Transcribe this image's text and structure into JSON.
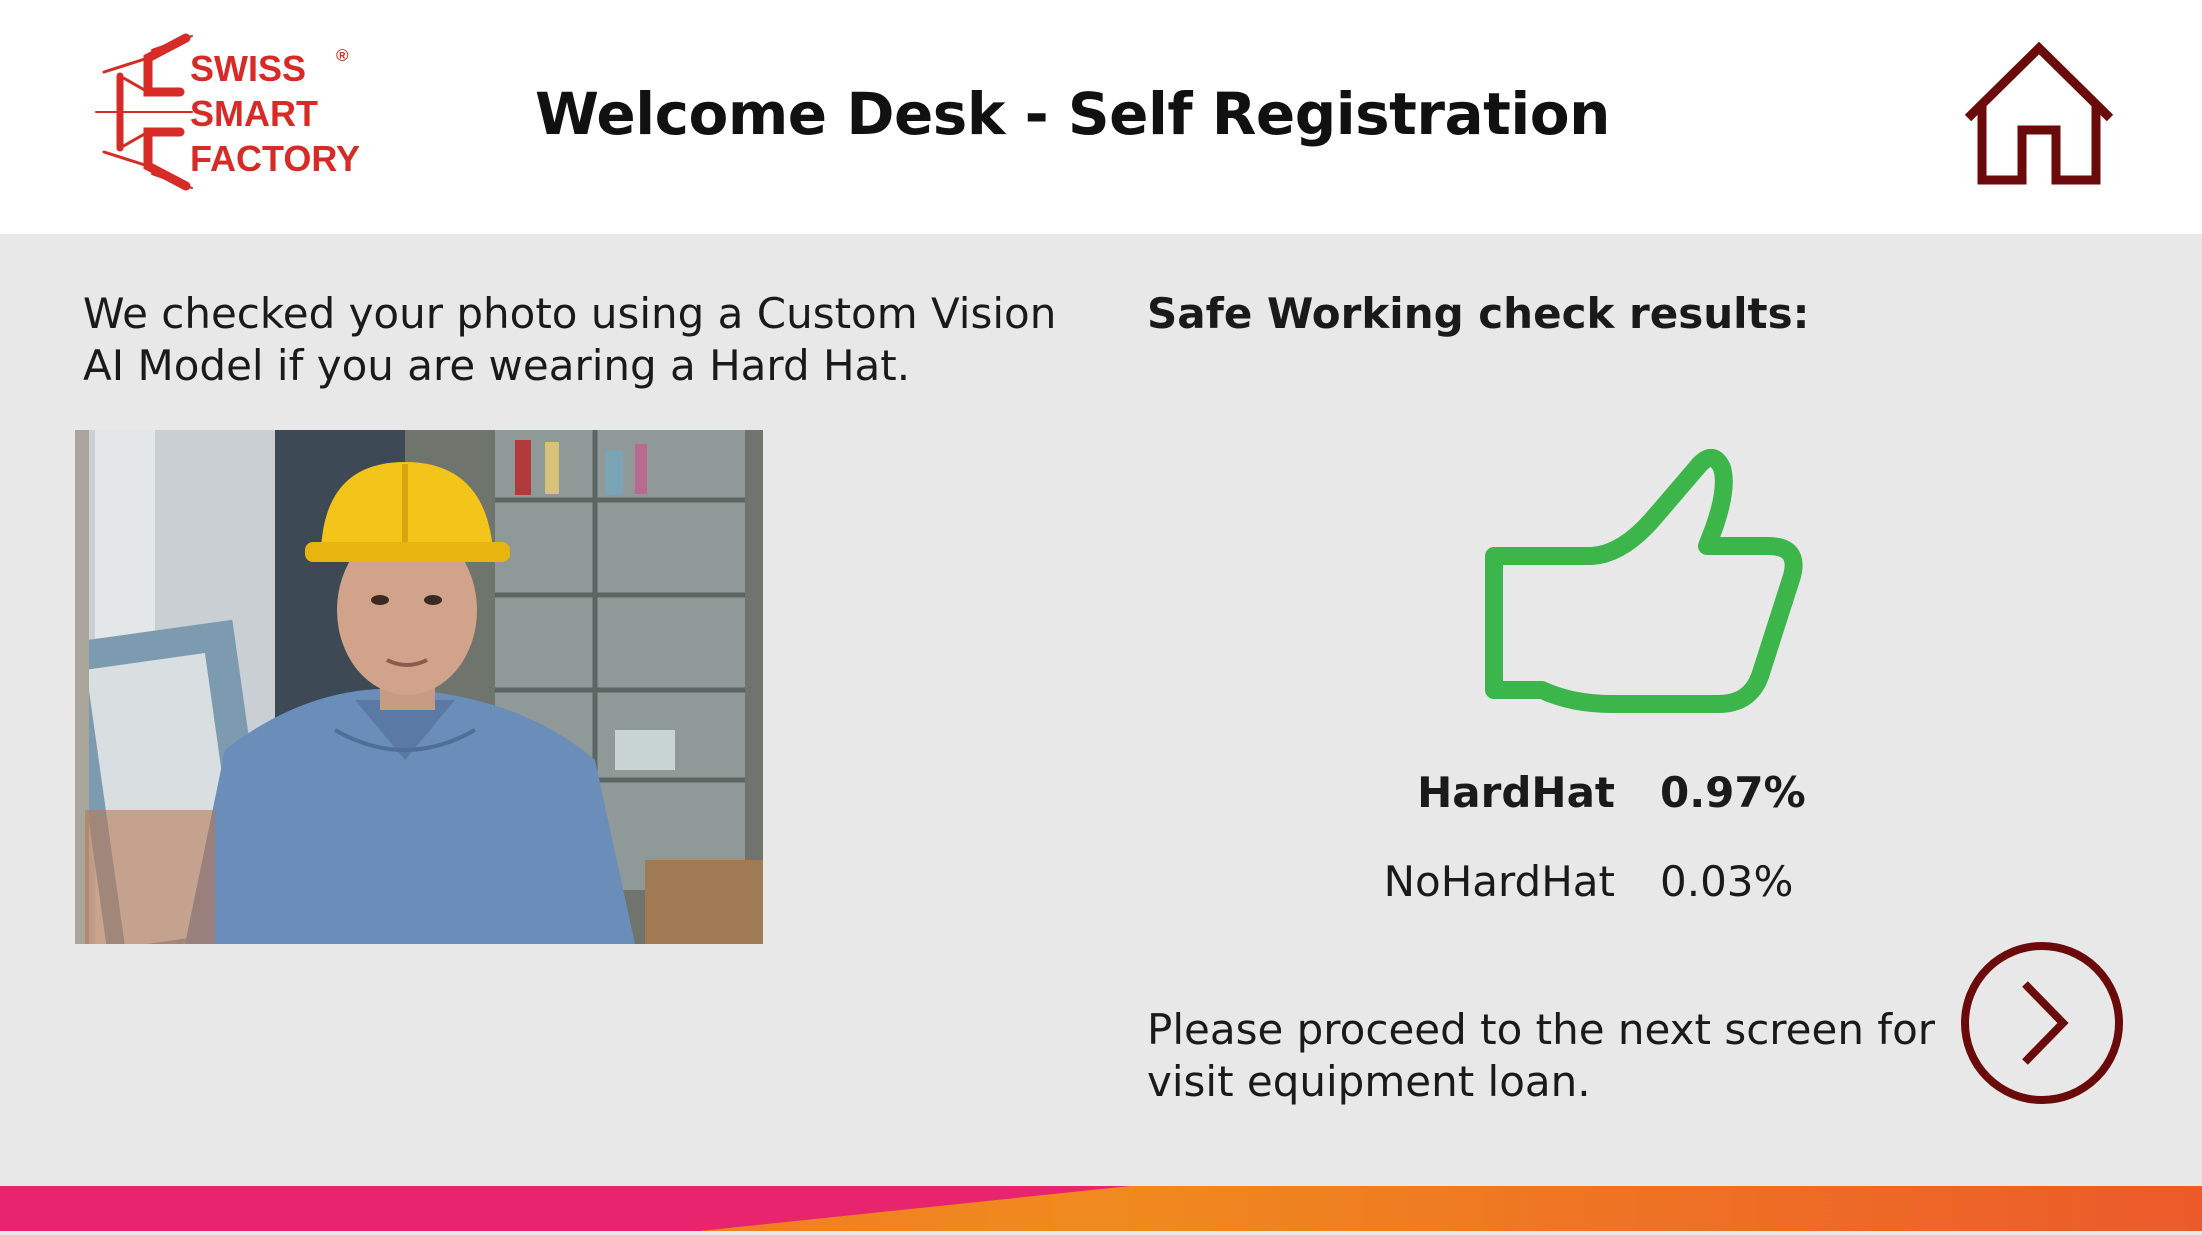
{
  "header": {
    "logo": {
      "lines": [
        "SWISS",
        "SMART",
        "FACTORY"
      ],
      "registered": "®",
      "color": "#d62b27"
    },
    "title": "Welcome Desk - Self Registration",
    "home_icon": "home-icon"
  },
  "main": {
    "intro_lines": [
      "We checked your photo using a Custom Vision",
      "AI Model if you are wearing a Hard Hat."
    ],
    "results_heading": "Safe Working check results:",
    "result_icon": "thumbs-up-icon",
    "result_color": "#3cb54a",
    "results": [
      {
        "label": "HardHat",
        "value": "0.97%"
      },
      {
        "label": "NoHardHat",
        "value": "0.03%"
      }
    ],
    "proceed_lines": [
      "Please proceed to the next screen for",
      "visit equipment loan."
    ],
    "next_icon": "chevron-right-icon"
  },
  "theme": {
    "accent_dark_red": "#6b0a0a",
    "background": "#e8e8e8",
    "footer_gradient": [
      "#e8246e",
      "#f08a1e",
      "#ec6a2a"
    ]
  }
}
